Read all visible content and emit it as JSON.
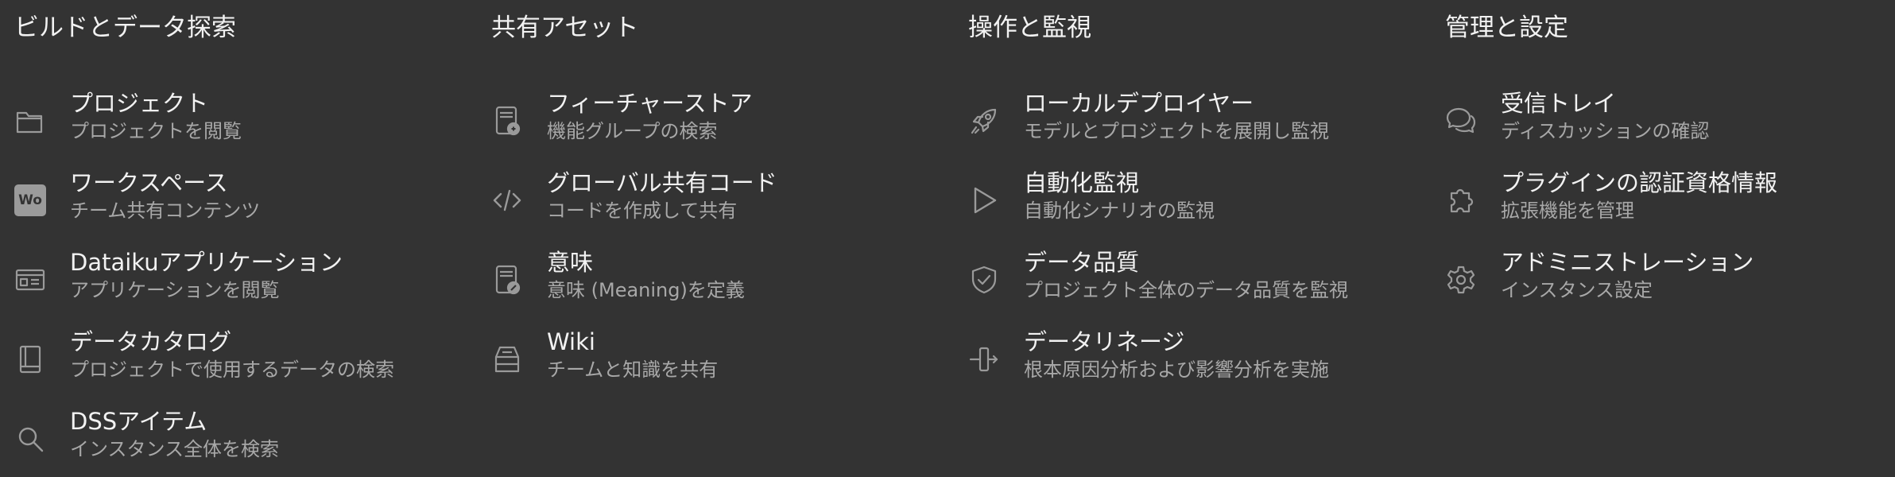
{
  "columns": [
    {
      "title": "ビルドとデータ探索",
      "items": [
        {
          "label": "プロジェクト",
          "description": "プロジェクトを閲覧",
          "icon": "folder-icon"
        },
        {
          "label": "ワークスペース",
          "description": "チーム共有コンテンツ",
          "icon": "workspace-icon",
          "badge_text": "Wo"
        },
        {
          "label": "Dataikuアプリケーション",
          "description": "アプリケーションを閲覧",
          "icon": "application-icon"
        },
        {
          "label": "データカタログ",
          "description": "プロジェクトで使用するデータの検索",
          "icon": "catalog-book-icon"
        },
        {
          "label": "DSSアイテム",
          "description": "インスタンス全体を検索",
          "icon": "search-icon"
        }
      ]
    },
    {
      "title": "共有アセット",
      "items": [
        {
          "label": "フィーチャーストア",
          "description": "機能グループの検索",
          "icon": "feature-store-icon"
        },
        {
          "label": "グローバル共有コード",
          "description": "コードを作成して共有",
          "icon": "code-icon"
        },
        {
          "label": "意味",
          "description": "意味 (Meaning)を定義",
          "icon": "meaning-icon"
        },
        {
          "label": "Wiki",
          "description": "チームと知識を共有",
          "icon": "wiki-icon"
        }
      ]
    },
    {
      "title": "操作と監視",
      "items": [
        {
          "label": "ローカルデプロイヤー",
          "description": "モデルとプロジェクトを展開し監視",
          "icon": "rocket-icon"
        },
        {
          "label": "自動化監視",
          "description": "自動化シナリオの監視",
          "icon": "play-icon"
        },
        {
          "label": "データ品質",
          "description": "プロジェクト全体のデータ品質を監視",
          "icon": "shield-check-icon"
        },
        {
          "label": "データリネージ",
          "description": "根本原因分析および影響分析を実施",
          "icon": "lineage-icon"
        }
      ]
    },
    {
      "title": "管理と設定",
      "items": [
        {
          "label": "受信トレイ",
          "description": "ディスカッションの確認",
          "icon": "chat-bubbles-icon"
        },
        {
          "label": "プラグインの認証資格情報",
          "description": "拡張機能を管理",
          "icon": "puzzle-piece-icon"
        },
        {
          "label": "アドミニストレーション",
          "description": "インスタンス設定",
          "icon": "gear-icon"
        }
      ]
    }
  ]
}
